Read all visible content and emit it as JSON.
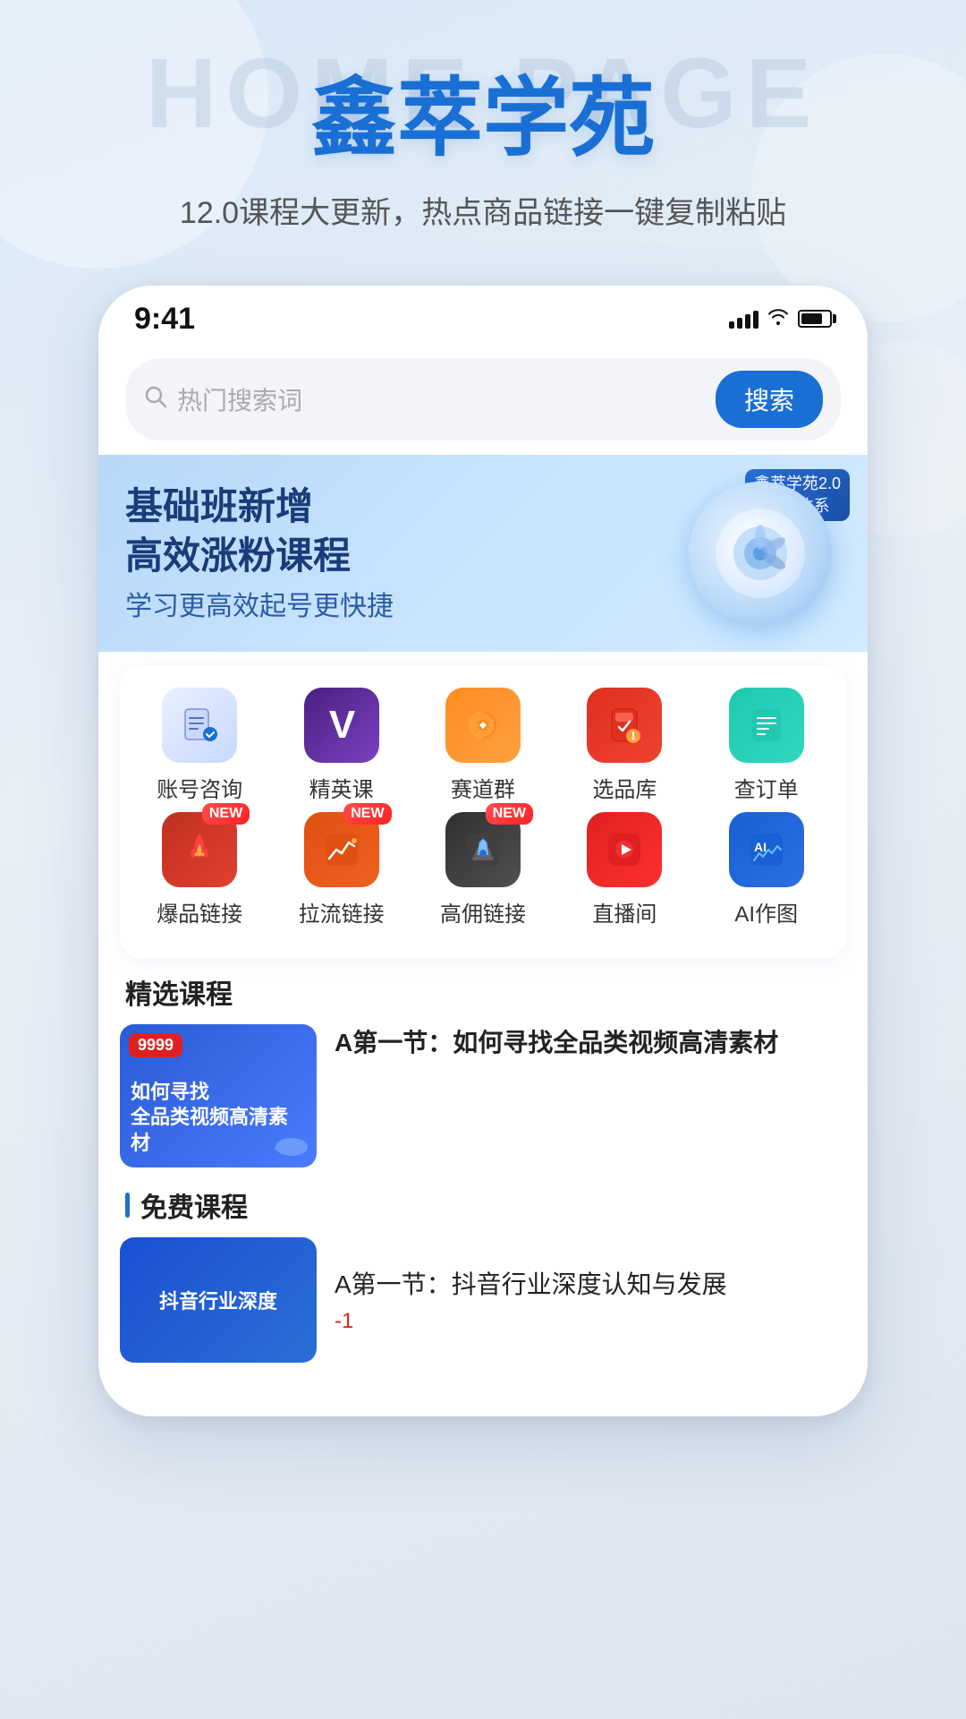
{
  "background": {
    "bg_text": "HOME PAGE"
  },
  "header": {
    "app_title": "鑫萃学苑",
    "subtitle": "12.0课程大更新，热点商品链接一键复制粘贴"
  },
  "status_bar": {
    "time": "9:41"
  },
  "search": {
    "placeholder": "热门搜索词",
    "button_label": "搜索"
  },
  "banner": {
    "title_line1": "基础班新增",
    "title_line2": "高效涨粉课程",
    "subtitle": "学习更高效起号更快捷",
    "badge_line1": "鑫萃学苑2.0",
    "badge_line2": "支付体系"
  },
  "grid_menu": {
    "rows": [
      [
        {
          "id": "account",
          "label": "账号咨询",
          "icon_class": "icon-account",
          "icon": "📋",
          "new": false
        },
        {
          "id": "elite",
          "label": "精英课",
          "icon_class": "icon-elite",
          "icon": "V",
          "new": false
        },
        {
          "id": "race",
          "label": "赛道群",
          "icon_class": "icon-race",
          "icon": "🔄",
          "new": false
        },
        {
          "id": "select",
          "label": "选品库",
          "icon_class": "icon-select",
          "icon": "📊",
          "new": false
        },
        {
          "id": "order",
          "label": "查订单",
          "icon_class": "icon-order",
          "icon": "📋",
          "new": false
        }
      ],
      [
        {
          "id": "hot",
          "label": "爆品链接",
          "icon_class": "icon-hot",
          "icon": "🔥",
          "new": true
        },
        {
          "id": "pull",
          "label": "拉流链接",
          "icon_class": "icon-pull",
          "icon": "📈",
          "new": true
        },
        {
          "id": "high",
          "label": "高佣链接",
          "icon_class": "icon-high",
          "icon": "👍",
          "new": true
        },
        {
          "id": "live",
          "label": "直播间",
          "icon_class": "icon-live",
          "icon": "▶",
          "new": false
        },
        {
          "id": "ai",
          "label": "AI作图",
          "icon_class": "icon-ai",
          "icon": "AI",
          "new": false
        }
      ]
    ]
  },
  "selected_courses": {
    "section_title": "精选课程",
    "courses": [
      {
        "badge": "9999",
        "thumb_text": "如何寻找\n全品类视频高清素材",
        "title": "A第一节：如何寻找全品类视频高清素材"
      }
    ]
  },
  "free_courses": {
    "section_title": "免费课程",
    "courses": [
      {
        "thumb_text": "抖音行业深度",
        "title": "A第一节：抖音行业深度认知与发展",
        "sub_label": "-1"
      }
    ]
  }
}
